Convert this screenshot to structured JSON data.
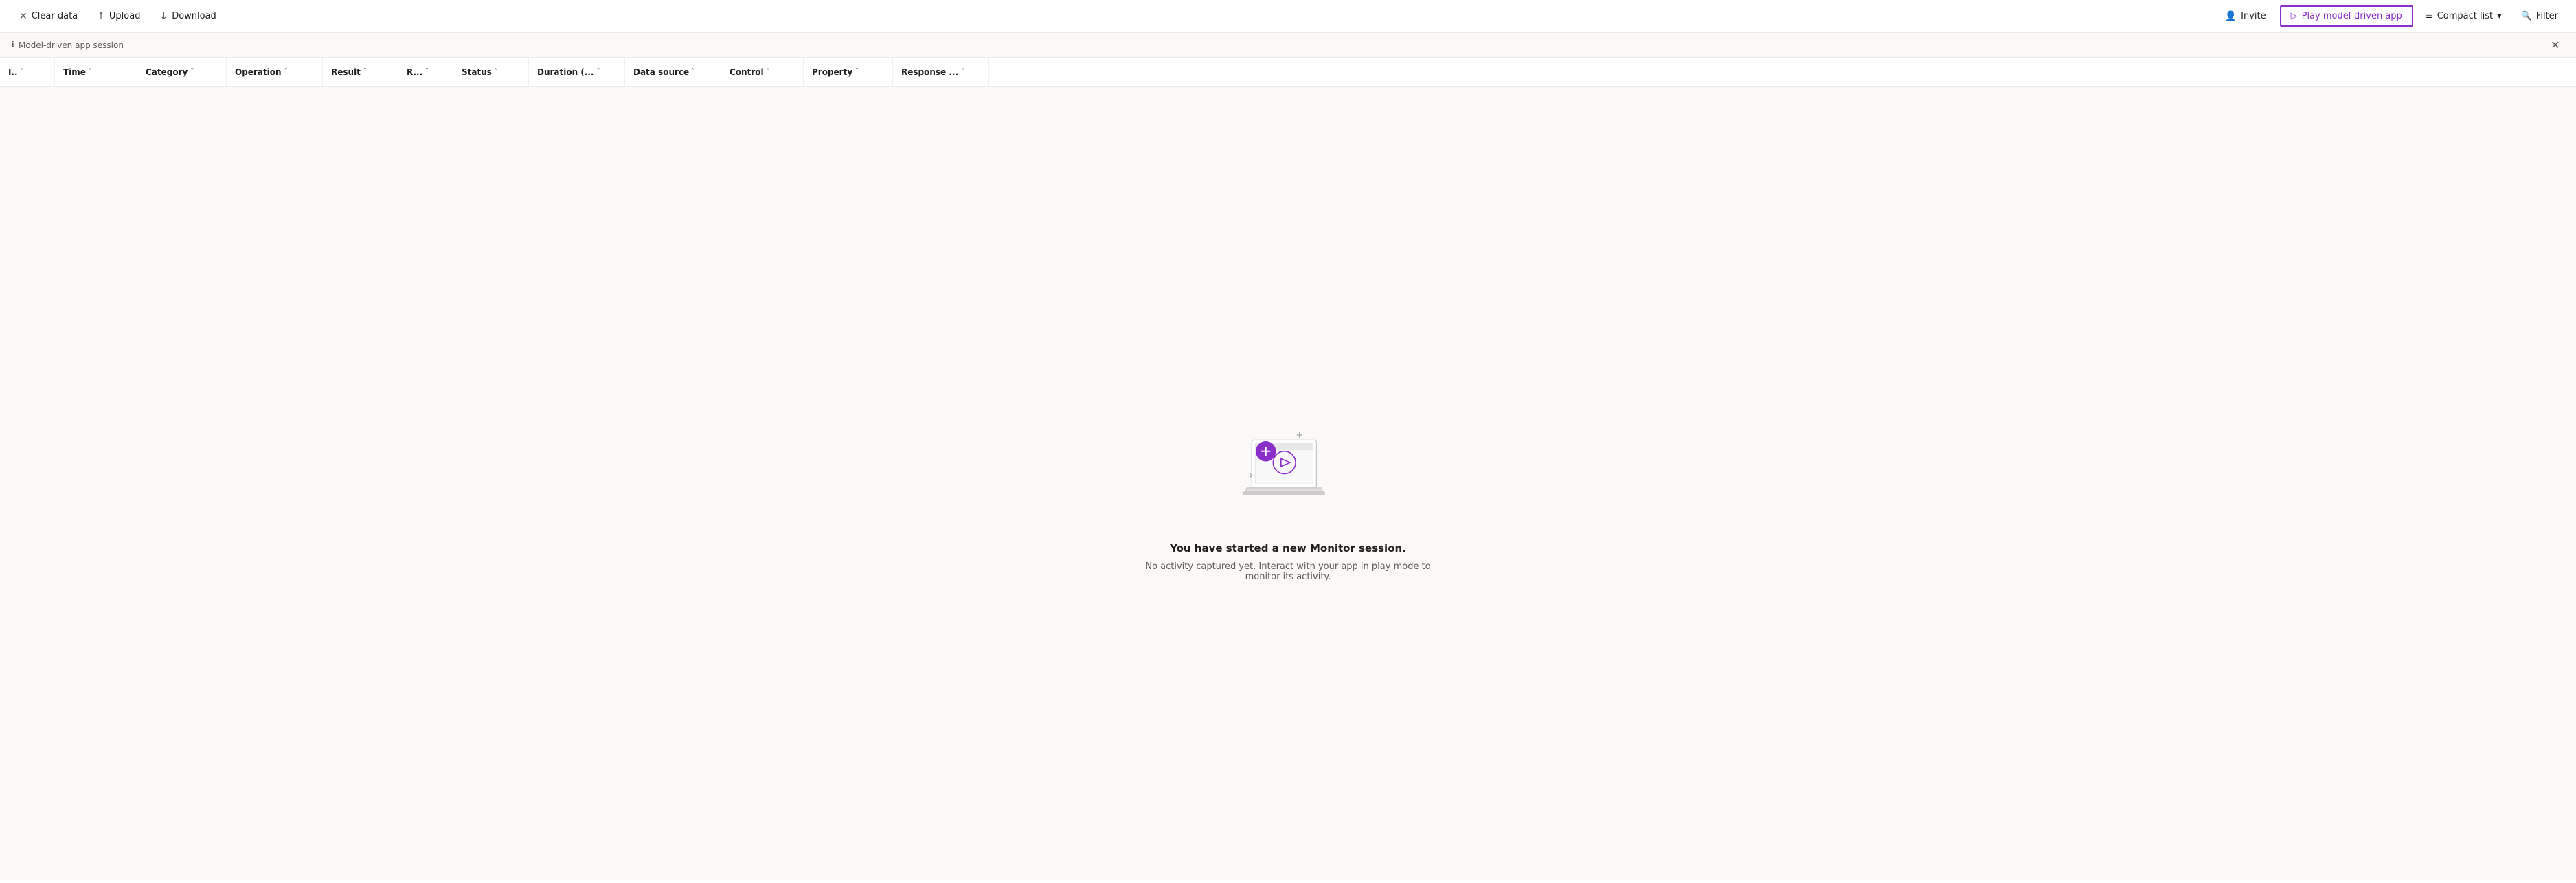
{
  "toolbar": {
    "clear_data_label": "Clear data",
    "upload_label": "Upload",
    "download_label": "Download",
    "invite_label": "Invite",
    "play_model_driven_label": "Play model-driven app",
    "compact_list_label": "Compact list",
    "filter_label": "Filter"
  },
  "session": {
    "label": "Model-driven app session"
  },
  "columns": [
    {
      "id": "col-id",
      "label": "I..",
      "class": "col-id"
    },
    {
      "id": "col-time",
      "label": "Time",
      "class": "col-time"
    },
    {
      "id": "col-category",
      "label": "Category",
      "class": "col-category"
    },
    {
      "id": "col-operation",
      "label": "Operation",
      "class": "col-operation"
    },
    {
      "id": "col-result",
      "label": "Result",
      "class": "col-result"
    },
    {
      "id": "col-r",
      "label": "R...",
      "class": "col-r"
    },
    {
      "id": "col-status",
      "label": "Status",
      "class": "col-status"
    },
    {
      "id": "col-duration",
      "label": "Duration (...",
      "class": "col-duration"
    },
    {
      "id": "col-datasource",
      "label": "Data source",
      "class": "col-datasource"
    },
    {
      "id": "col-control",
      "label": "Control",
      "class": "col-control"
    },
    {
      "id": "col-property",
      "label": "Property",
      "class": "col-property"
    },
    {
      "id": "col-response",
      "label": "Response ...",
      "class": "col-response"
    }
  ],
  "empty_state": {
    "title": "You have started a new Monitor session.",
    "subtitle": "No activity captured yet. Interact with your app in play mode to monitor its activity."
  },
  "colors": {
    "accent": "#8b2fc9",
    "accent_light": "#f3e8fc"
  }
}
